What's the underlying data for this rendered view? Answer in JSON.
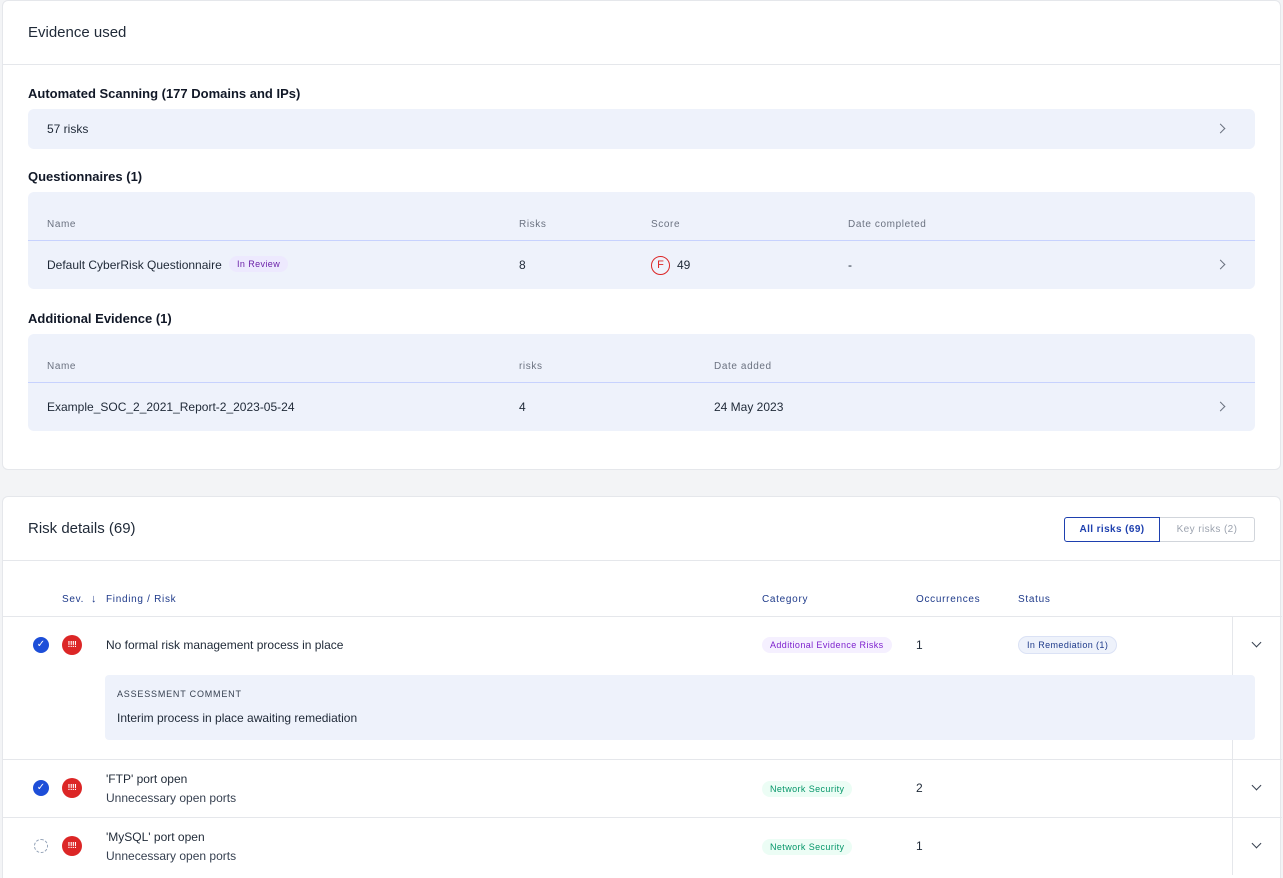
{
  "evidence": {
    "title": "Evidence used",
    "automated": {
      "title": "Automated Scanning (177 Domains and IPs)",
      "summary": "57 risks"
    },
    "questionnaires": {
      "title": "Questionnaires (1)",
      "headers": {
        "name": "Name",
        "risks": "Risks",
        "score": "Score",
        "date": "Date completed"
      },
      "rows": [
        {
          "name": "Default CyberRisk Questionnaire",
          "badge": "In Review",
          "risks": "8",
          "grade": "F",
          "score": "49",
          "date": "-"
        }
      ]
    },
    "additional": {
      "title": "Additional Evidence (1)",
      "headers": {
        "name": "Name",
        "risks": "risks",
        "date": "Date added"
      },
      "rows": [
        {
          "name": "Example_SOC_2_2021_Report-2_2023-05-24",
          "risks": "4",
          "date": "24 May 2023"
        }
      ]
    }
  },
  "risk_details": {
    "title": "Risk details (69)",
    "tabs": {
      "all": "All risks (69)",
      "key": "Key risks (2)"
    },
    "headers": {
      "severity": "Sev.",
      "finding": "Finding / Risk",
      "category": "Category",
      "occurrences": "Occurrences",
      "status": "Status"
    },
    "sort_arrow": "↓",
    "rows": [
      {
        "title": "No formal risk management process in place",
        "category": "Additional Evidence Risks",
        "occurrences": "1",
        "status": "In Remediation (1)",
        "comment_label": "ASSESSMENT COMMENT",
        "comment": "Interim process in place awaiting remediation",
        "sev_glyph": "!!!!",
        "verified": true
      },
      {
        "title": "'FTP' port open",
        "subtitle": "Unnecessary open ports",
        "category": "Network Security",
        "occurrences": "2",
        "sev_glyph": "!!!!",
        "verified": true
      },
      {
        "title": "'MySQL' port open",
        "subtitle": "Unnecessary open ports",
        "category": "Network Security",
        "occurrences": "1",
        "sev_glyph": "!!!!",
        "verified": false
      }
    ]
  },
  "colors": {
    "accent": "#1e40af",
    "panel_bg": "#eef2fb",
    "critical": "#dc2626",
    "network_badge": "#059669",
    "evidence_badge": "#7e22ce"
  },
  "icons": {
    "chevron_right": "chevron-right-icon",
    "chevron_down": "chevron-down-icon",
    "verified": "verified-check-icon",
    "unverified": "unverified-icon",
    "severity": "critical-severity-icon"
  }
}
